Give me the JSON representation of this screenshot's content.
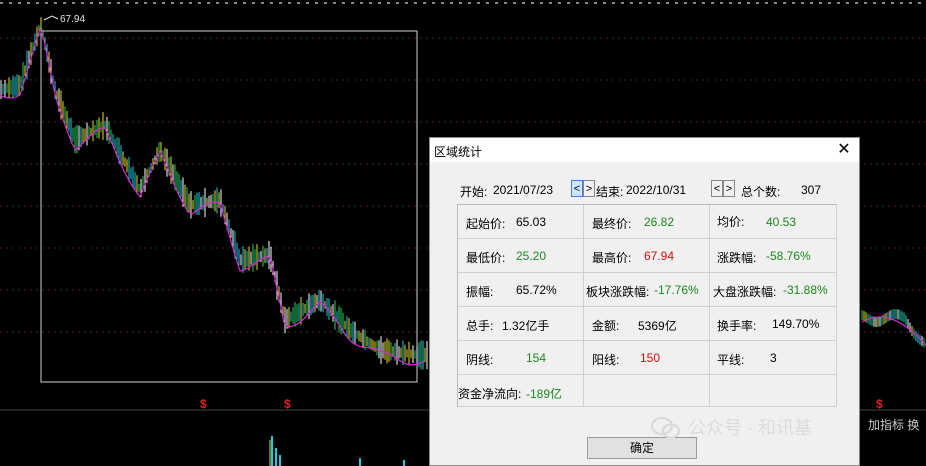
{
  "chart": {
    "peak_label": "67.94",
    "markers": [
      "$",
      "$",
      "$"
    ],
    "colors": {
      "background": "#000000",
      "price_line": "#ffffff",
      "ma_line": "#d52bd5",
      "cyan": "#20c8e0",
      "yellow": "#e8e020",
      "green": "#20d060",
      "red_volume": "#e03030",
      "selection_box": "#cfcfcf"
    }
  },
  "dialog": {
    "title": "区域统计",
    "close_glyph": "✕",
    "start_label": "开始:",
    "start_date": "2021/07/23",
    "end_label": "结束:",
    "end_date": "2022/10/31",
    "prev_glyph": "<",
    "next_glyph": ">",
    "total_label": "总个数:",
    "total_value": "307",
    "stats": {
      "start_price_label": "起始价:",
      "start_price": "65.03",
      "final_price_label": "最终价:",
      "final_price": "26.82",
      "avg_price_label": "均价:",
      "avg_price": "40.53",
      "low_label": "最低价:",
      "low": "25.20",
      "high_label": "最高价:",
      "high": "67.94",
      "change_label": "涨跌幅:",
      "change": "-58.76%",
      "amplitude_label": "振幅:",
      "amplitude": "65.72%",
      "sector_change_label": "板块涨跌幅:",
      "sector_change": "-17.76%",
      "market_change_label": "大盘涨跌幅:",
      "market_change": "-31.88%",
      "total_hands_label": "总手:",
      "total_hands": "1.32亿手",
      "amount_label": "金额:",
      "amount": "5369亿",
      "turnover_label": "换手率:",
      "turnover": "149.70%",
      "down_label": "阴线:",
      "down": "154",
      "up_label": "阳线:",
      "up": "150",
      "flat_label": "平线:",
      "flat": "3",
      "net_flow_label": "资金净流向:",
      "net_flow": "-189亿"
    },
    "ok_label": "确定"
  },
  "watermark": {
    "text": "公众号 · 和讯基",
    "right_text": "加指标  换"
  }
}
